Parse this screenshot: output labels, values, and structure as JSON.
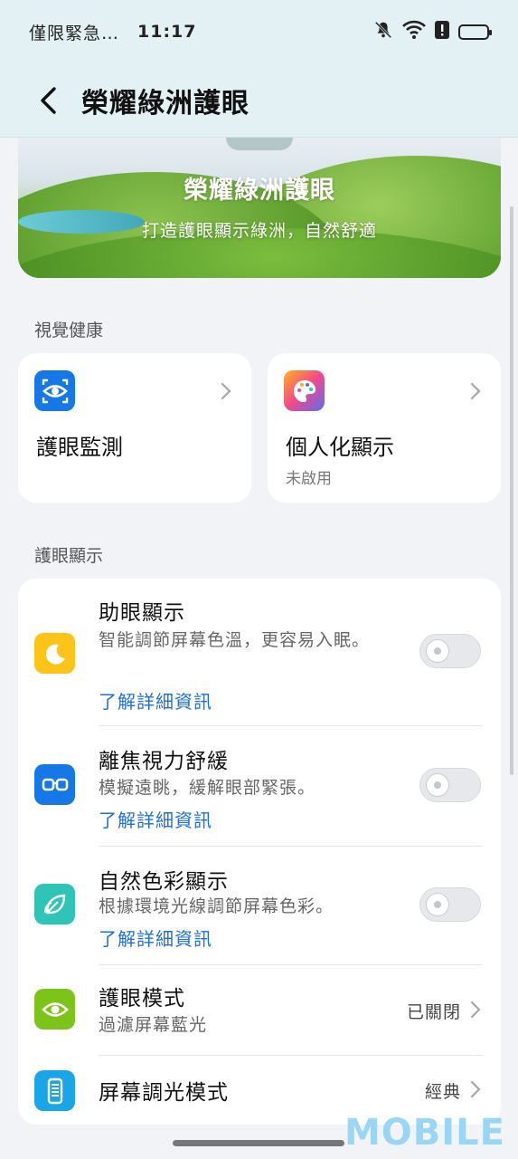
{
  "status_bar": {
    "carrier": "僅限緊急…",
    "time": "11:17",
    "icons": [
      "bell-off-icon",
      "wifi-icon",
      "alert-icon",
      "battery-icon"
    ]
  },
  "header": {
    "back_icon": "chevron-left-icon",
    "title": "榮耀綠洲護眼"
  },
  "banner": {
    "title": "榮耀綠洲護眼",
    "subtitle": "打造護眼顯示綠洲，自然舒適"
  },
  "sections": {
    "visual_health": "視覺健康",
    "eye_display": "護眼顯示"
  },
  "cards": [
    {
      "icon": "eye-monitor-icon",
      "title": "護眼監測",
      "subtitle": "",
      "color": "#1677e6"
    },
    {
      "icon": "palette-icon",
      "title": "個人化顯示",
      "subtitle": "未啟用",
      "color": "#f04a8c"
    }
  ],
  "rows": [
    {
      "icon": "moon-icon",
      "color": "#fcc419",
      "title": "助眼顯示",
      "desc": "智能調節屏幕色溫，更容易入眠。",
      "link": "了解詳細資訊",
      "toggle": false
    },
    {
      "icon": "glasses-icon",
      "color": "#1677e6",
      "title": "離焦視力舒緩",
      "desc": "模擬遠眺，緩解眼部緊張。",
      "link": "了解詳細資訊",
      "toggle": false
    },
    {
      "icon": "leaf-icon",
      "color": "#2ec4b6",
      "title": "自然色彩顯示",
      "desc": "根據環境光線調節屏幕色彩。",
      "link": "了解詳細資訊",
      "toggle": false
    },
    {
      "icon": "eye-icon",
      "color": "#7cc41a",
      "title": "護眼模式",
      "desc": "過濾屏幕藍光",
      "value": "已關閉"
    },
    {
      "icon": "dimming-icon",
      "color": "#1aa6e6",
      "title": "屏幕調光模式",
      "value": "經典"
    }
  ],
  "watermark": "MOBILE"
}
